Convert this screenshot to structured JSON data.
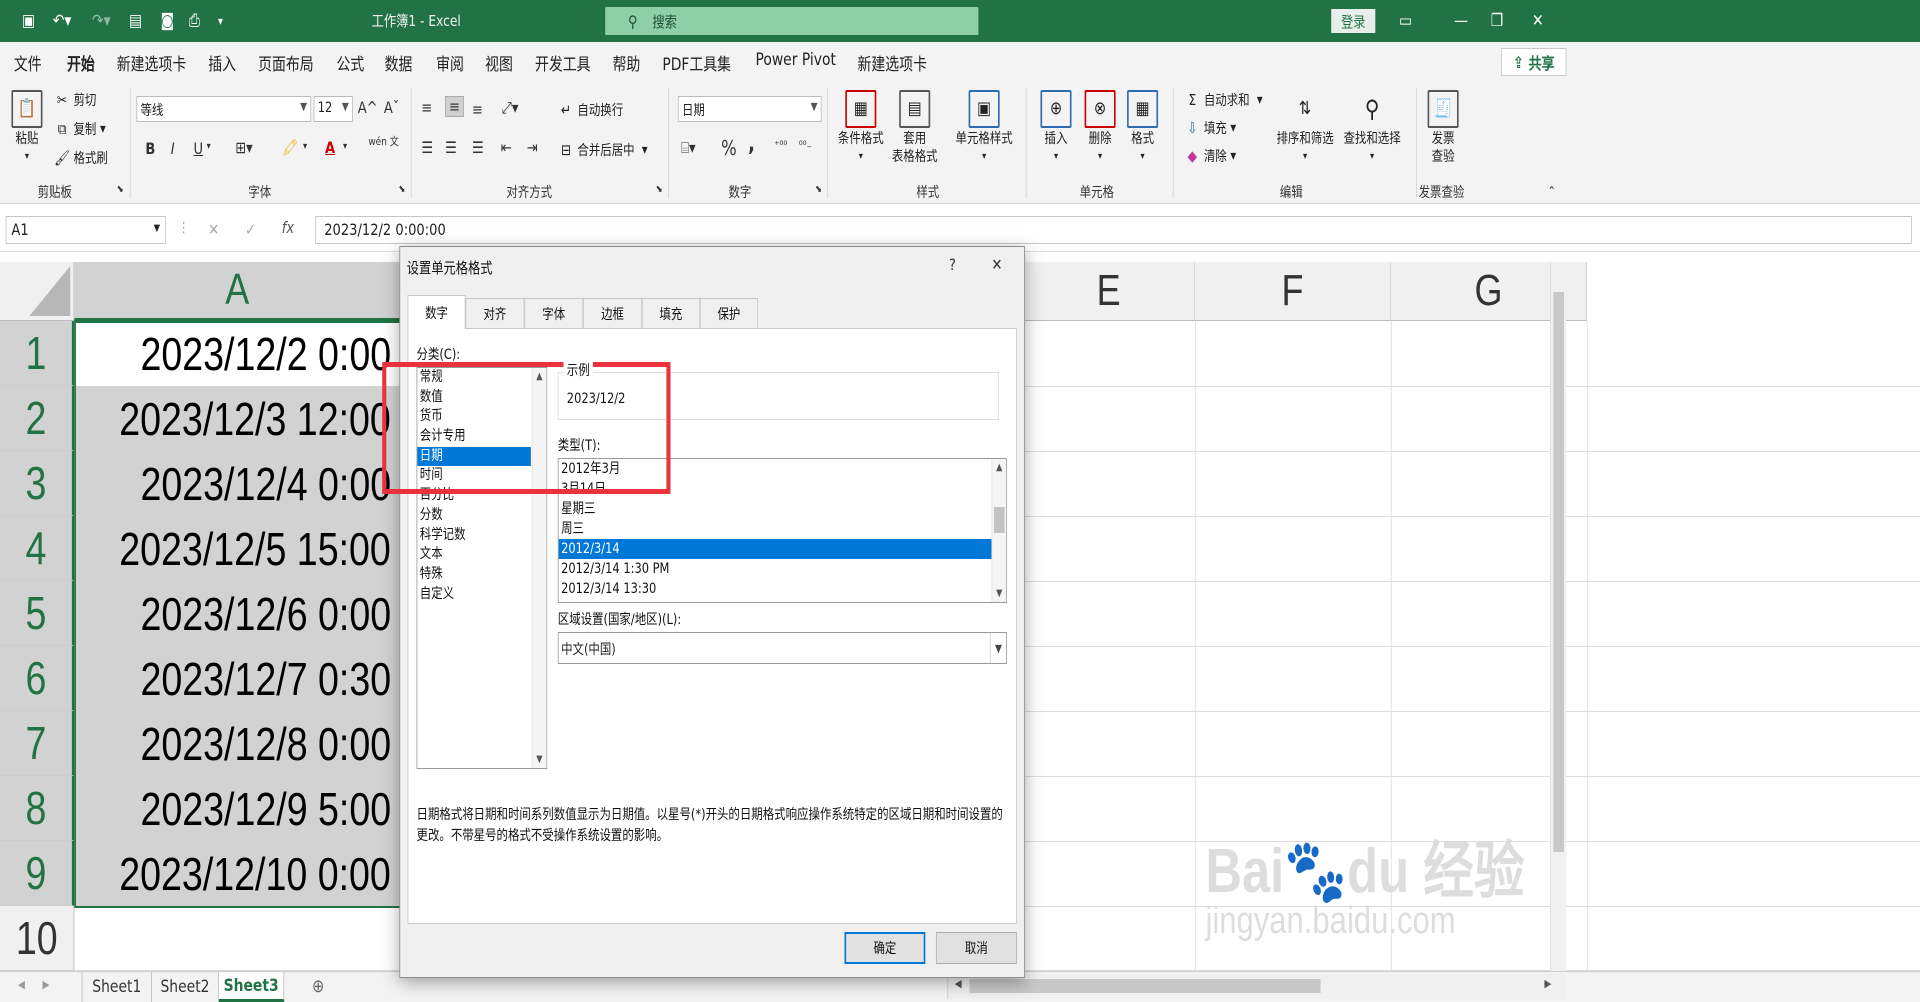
{
  "window": {
    "title": "工作簿1 - Excel",
    "search_placeholder": "搜索",
    "login": "登录",
    "share": "共享"
  },
  "qat": {
    "icons": [
      "save-icon",
      "undo-icon",
      "redo-icon",
      "form-icon",
      "camera-icon",
      "print-preview-icon",
      "customize-icon"
    ]
  },
  "menu": [
    "文件",
    "开始",
    "新建选项卡",
    "插入",
    "页面布局",
    "公式",
    "数据",
    "审阅",
    "视图",
    "开发工具",
    "帮助",
    "PDF工具集",
    "Power Pivot",
    "新建选项卡"
  ],
  "ribbon": {
    "clipboard": {
      "paste": "粘贴",
      "cut": "剪切",
      "copy": "复制",
      "format_painter": "格式刷",
      "label": "剪贴板"
    },
    "font": {
      "name": "等线",
      "size": "12",
      "label": "字体",
      "grow": "A^",
      "shrink": "Aˇ",
      "bold": "B",
      "italic": "I",
      "underline": "U",
      "wen": "wén 文"
    },
    "alignment": {
      "wrap": "自动换行",
      "merge": "合并后居中",
      "label": "对齐方式"
    },
    "number": {
      "format": "日期",
      "pct": "%",
      "comma": ",",
      "label": "数字"
    },
    "styles": {
      "conditional": "条件格式",
      "table1": "套用",
      "table2": "表格格式",
      "cell": "单元格样式",
      "label": "样式"
    },
    "cells": {
      "insert": "插入",
      "delete": "删除",
      "format": "格式",
      "label": "单元格"
    },
    "editing": {
      "autosum": "自动求和",
      "fill": "填充",
      "clear": "清除",
      "sort": "排序和筛选",
      "find": "查找和选择",
      "label": "编辑"
    },
    "invoice": {
      "btn1": "发票",
      "btn2": "查验",
      "label": "发票查验"
    }
  },
  "formula_bar": {
    "name_box": "A1",
    "formula": "2023/12/2  0:00:00",
    "cancel": "✕",
    "enter": "✓",
    "fx": "fx"
  },
  "columns": [
    "A",
    "E",
    "F",
    "G"
  ],
  "rows": [
    "1",
    "2",
    "3",
    "4",
    "5",
    "6",
    "7",
    "8",
    "9",
    "10"
  ],
  "cells_a": [
    "2023/12/2 0:00",
    "2023/12/3 12:00",
    "2023/12/4 0:00",
    "2023/12/5 15:00",
    "2023/12/6 0:00",
    "2023/12/7 0:30",
    "2023/12/8 0:00",
    "2023/12/9 5:00",
    "2023/12/10 0:00"
  ],
  "sheets": [
    "Sheet1",
    "Sheet2",
    "Sheet3"
  ],
  "dialog": {
    "title": "设置单元格格式",
    "help": "?",
    "close": "✕",
    "tabs": [
      "数字",
      "对齐",
      "字体",
      "边框",
      "填充",
      "保护"
    ],
    "category_label": "分类(C):",
    "categories": [
      "常规",
      "数值",
      "货币",
      "会计专用",
      "日期",
      "时间",
      "百分比",
      "分数",
      "科学记数",
      "文本",
      "特殊",
      "自定义"
    ],
    "selected_category": "日期",
    "sample_label": "示例",
    "sample_value": "2023/12/2",
    "type_label": "类型(T):",
    "types": [
      "2012年3月",
      "3月14日",
      "星期三",
      "周三",
      "2012/3/14",
      "2012/3/14 1:30 PM",
      "2012/3/14 13:30"
    ],
    "selected_type": "2012/3/14",
    "locale_label": "区域设置(国家/地区)(L):",
    "locale_value": "中文(中国)",
    "description": "日期格式将日期和时间系列数值显示为日期值。以星号(*)开头的日期格式响应操作系统特定的区域日期和时间设置的更改。不带星号的格式不受操作系统设置的影响。",
    "ok": "确定",
    "cancel": "取消"
  },
  "watermark": {
    "logo": "Bai du 经验",
    "url": "jingyan.baidu.com"
  },
  "colors": {
    "excel_green": "#217346",
    "highlight": "#e8333c",
    "selection": "#0078d7"
  }
}
